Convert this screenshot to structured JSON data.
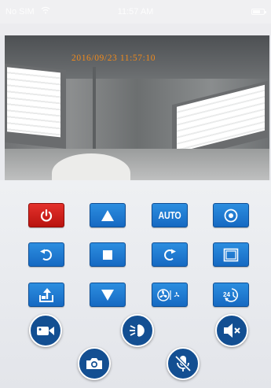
{
  "status_bar": {
    "carrier": "No SIM",
    "time": "11:57 AM"
  },
  "camera": {
    "timestamp": "2016/09/23 11:57:10"
  },
  "controls": {
    "auto_label": "AUTO",
    "power_color": "#d1201b",
    "button_color": "#1f7bd3",
    "round_button_color": "#134f92"
  },
  "icons": {
    "power": "power-icon",
    "up": "arrow-up-icon",
    "auto": "auto-text",
    "record": "record-circle-icon",
    "rotate_left": "rotate-left-icon",
    "stop": "stop-square-icon",
    "rotate_right": "rotate-right-icon",
    "frame": "frame-square-icon",
    "exit": "exit-arrow-icon",
    "down": "arrow-down-icon",
    "fan": "fan-speed-icon",
    "timer": "timer-24h-icon",
    "video": "video-camera-icon",
    "light": "light-beam-icon",
    "volume": "speaker-mute-icon",
    "photo": "photo-camera-icon",
    "mic": "mic-mute-icon"
  }
}
